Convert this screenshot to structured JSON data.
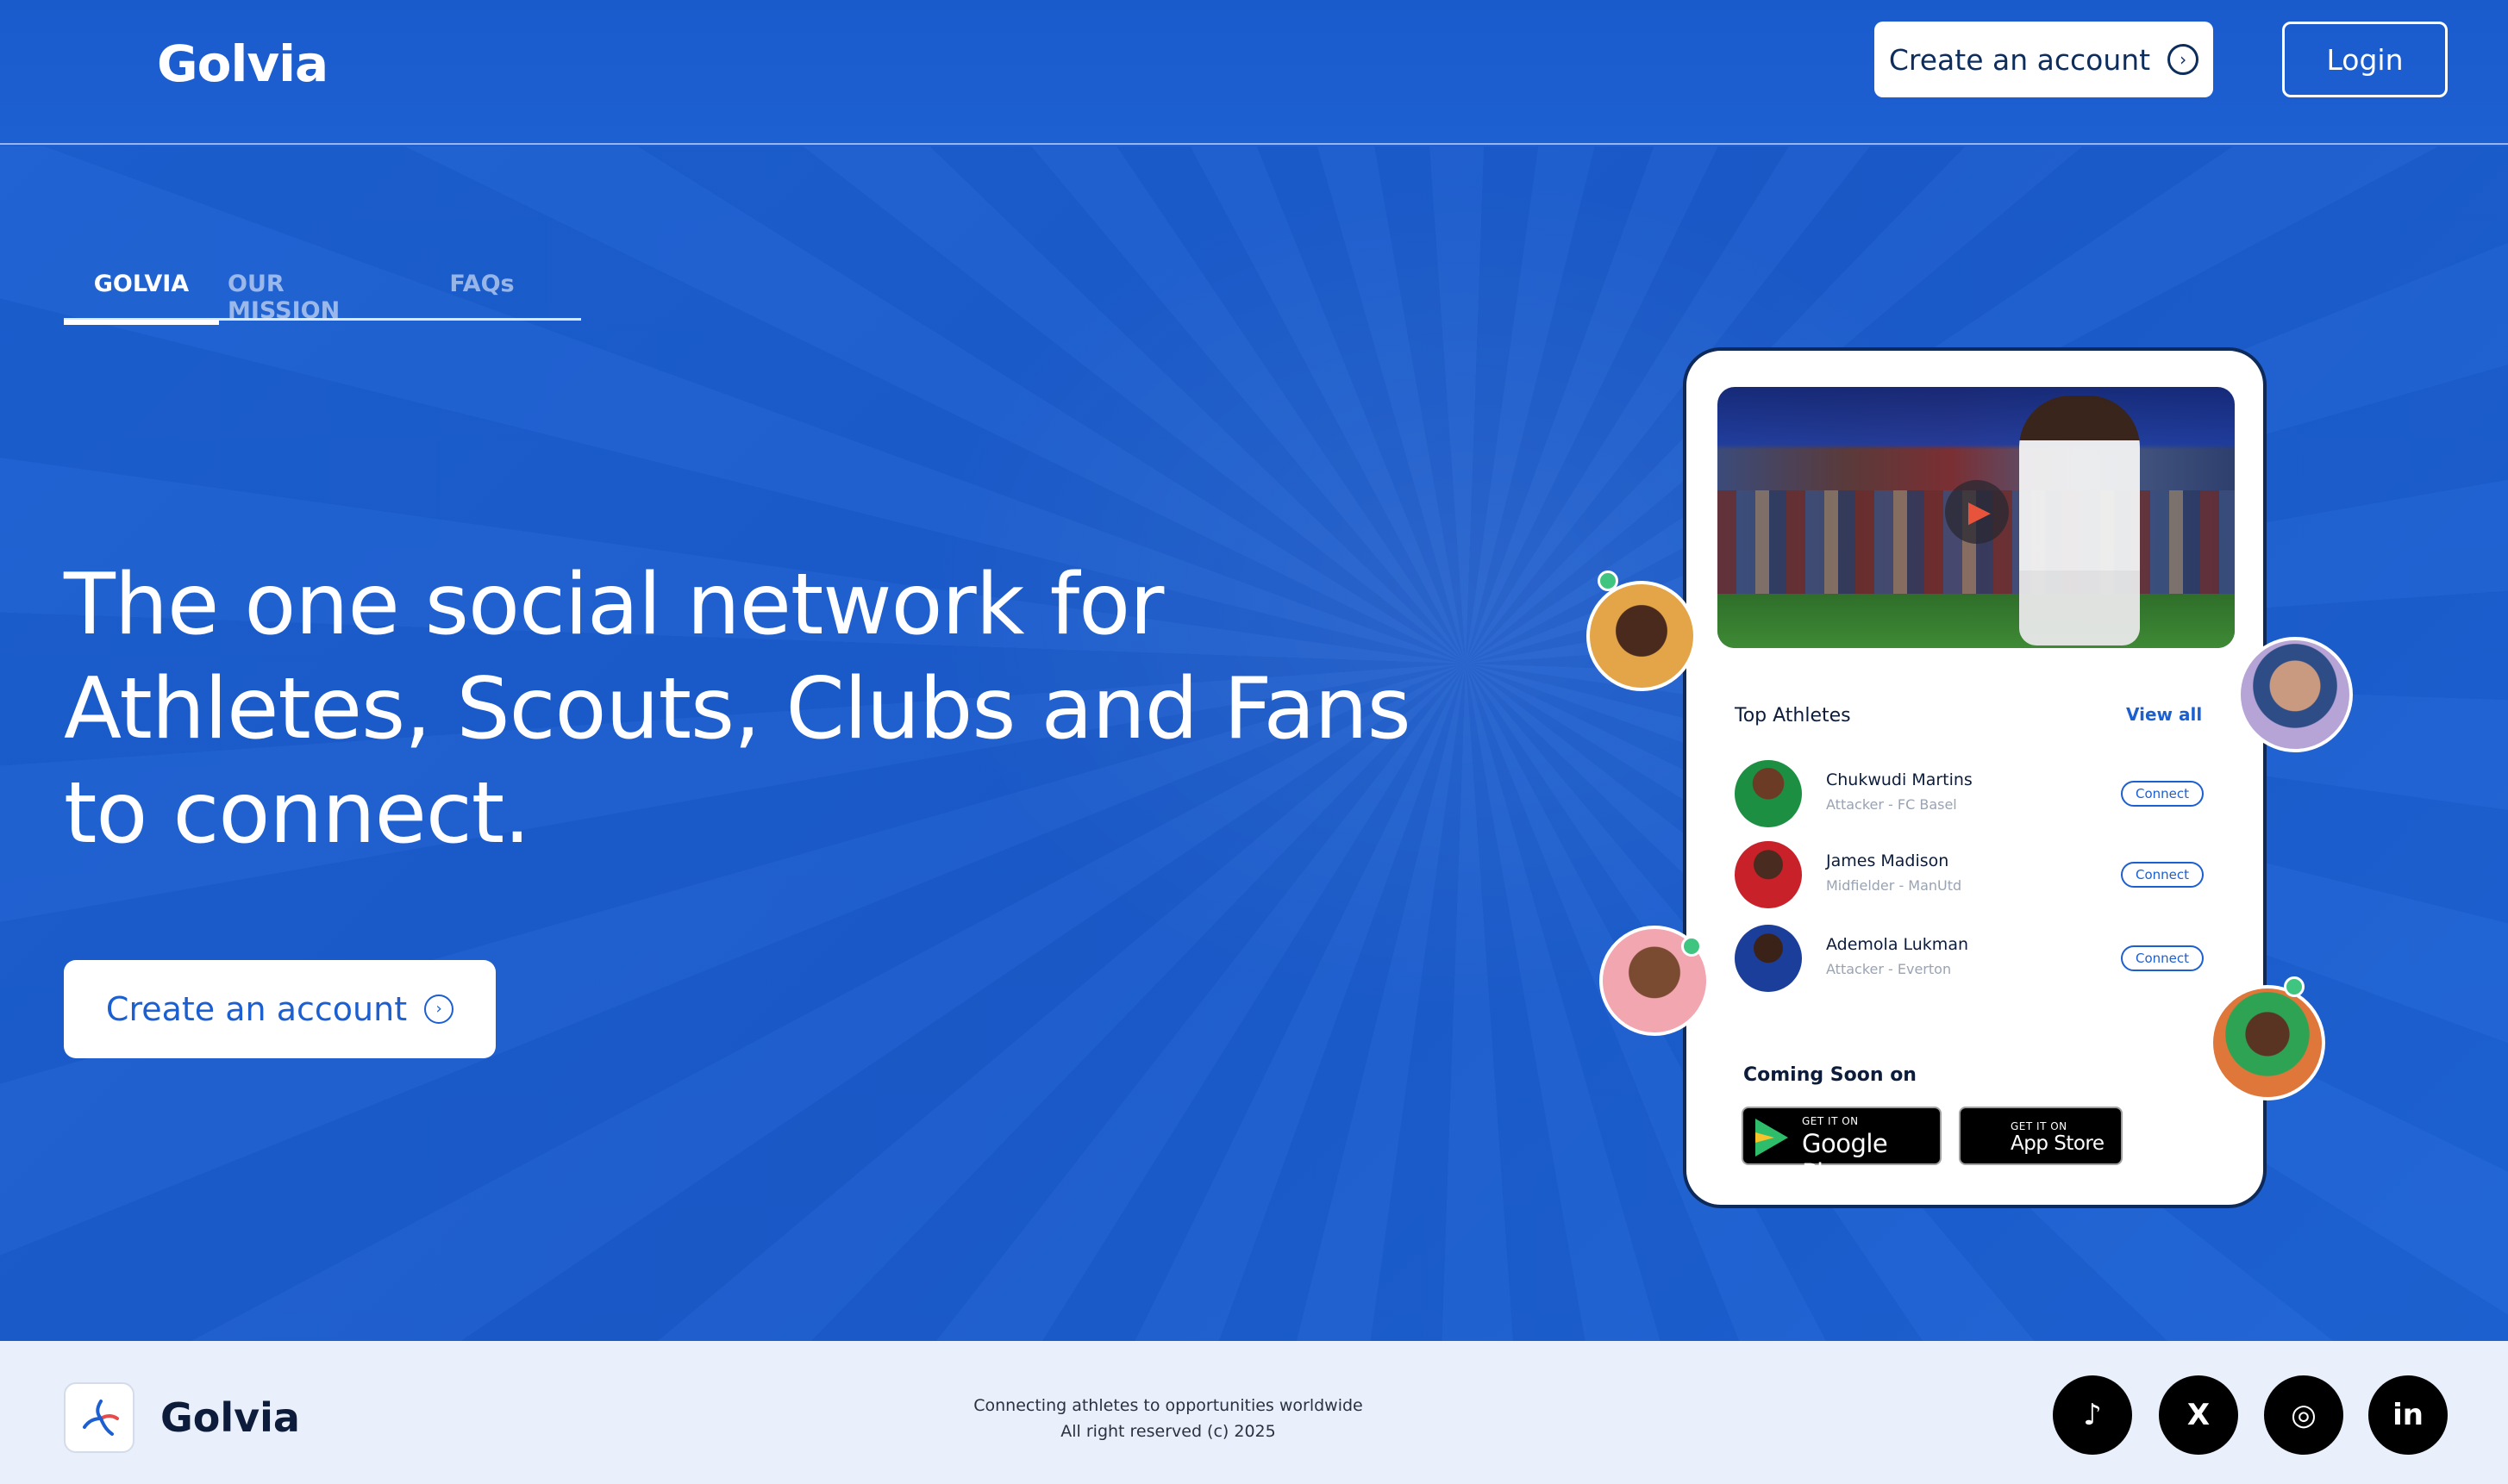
{
  "header": {
    "brand": "Golvia",
    "create_account_label": "Create an account",
    "login_label": "Login"
  },
  "tabs": [
    {
      "label": "GOLVIA",
      "active": true
    },
    {
      "label": "OUR MISSION",
      "active": false
    },
    {
      "label": "FAQs",
      "active": false
    }
  ],
  "hero": {
    "headline_lines": [
      "The one social network for",
      "Athletes, Scouts, Clubs and Fans",
      "to connect."
    ],
    "cta_label": "Create an account"
  },
  "phone": {
    "top_athletes_title": "Top Athletes",
    "view_all_label": "View all",
    "athletes": [
      {
        "name": "Chukwudi Martins",
        "role": "Attacker - FC Basel",
        "action": "Connect"
      },
      {
        "name": "James Madison",
        "role": "Midfielder - ManUtd",
        "action": "Connect"
      },
      {
        "name": "Ademola Lukman",
        "role": "Attacker - Everton",
        "action": "Connect"
      }
    ],
    "coming_soon_label": "Coming Soon on",
    "google_play": {
      "small": "GET IT ON",
      "big": "Google Play"
    },
    "app_store": {
      "small": "GET IT ON",
      "big": "App Store"
    }
  },
  "footer": {
    "brand": "Golvia",
    "tagline": "Connecting athletes to opportunities worldwide",
    "copyright": "All right reserved (c) 2025",
    "social": [
      {
        "name": "tiktok-icon",
        "glyph": "♪"
      },
      {
        "name": "x-icon",
        "glyph": "X"
      },
      {
        "name": "instagram-icon",
        "glyph": "◎"
      },
      {
        "name": "linkedin-icon",
        "glyph": "in"
      }
    ]
  },
  "colors": {
    "primary": "#1c5fd1",
    "dark_text": "#0c1c3a",
    "online_dot": "#3fc57f",
    "footer_bg": "#e9effb"
  }
}
